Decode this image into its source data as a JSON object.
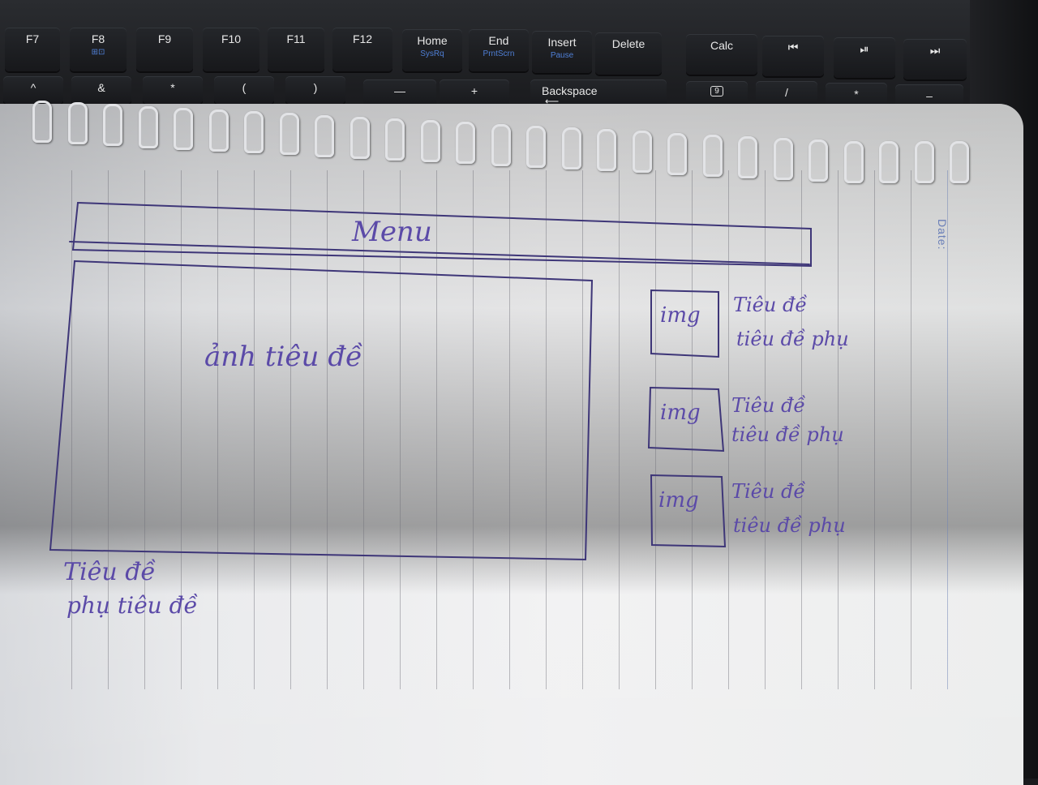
{
  "keyboard": {
    "row1": [
      {
        "id": "f7",
        "label": "F7",
        "sub": ""
      },
      {
        "id": "f8",
        "label": "F8",
        "sub": "⊞⊡"
      },
      {
        "id": "f9",
        "label": "F9",
        "sub": ""
      },
      {
        "id": "f10",
        "label": "F10",
        "sub": ""
      },
      {
        "id": "f11",
        "label": "F11",
        "sub": ""
      },
      {
        "id": "f12",
        "label": "F12",
        "sub": ""
      },
      {
        "id": "home",
        "label": "Home",
        "sub": "SysRq"
      },
      {
        "id": "end",
        "label": "End",
        "sub": "PrntScrn"
      },
      {
        "id": "insert",
        "label": "Insert",
        "sub": "Pause"
      },
      {
        "id": "delete",
        "label": "Delete",
        "sub": ""
      },
      {
        "id": "calc",
        "label": "Calc",
        "sub": ""
      },
      {
        "id": "prev",
        "label": "⏮",
        "sub": ""
      },
      {
        "id": "playpause",
        "label": "⏯",
        "sub": ""
      },
      {
        "id": "next",
        "label": "⏭",
        "sub": ""
      }
    ],
    "row2": [
      {
        "id": "caret",
        "label": "^"
      },
      {
        "id": "amp",
        "label": "&"
      },
      {
        "id": "star",
        "label": "*"
      },
      {
        "id": "lparen",
        "label": "("
      },
      {
        "id": "rparen",
        "label": ")"
      },
      {
        "id": "minus",
        "label": "—"
      },
      {
        "id": "plus",
        "label": "+"
      },
      {
        "id": "backspace",
        "label": "Backspace"
      },
      {
        "id": "lock",
        "label": "9"
      },
      {
        "id": "slash",
        "label": "/"
      },
      {
        "id": "npstar",
        "label": "*"
      },
      {
        "id": "npminus",
        "label": "–"
      }
    ]
  },
  "sketch": {
    "menu_label": "Menu",
    "hero_label": "ảnh tiêu đề",
    "hero_title": "Tiêu đề",
    "hero_subtitle": "phụ tiêu đề",
    "side_items": [
      {
        "img": "img",
        "title": "Tiêu đề",
        "subtitle": "tiêu đề phụ"
      },
      {
        "img": "img",
        "title": "Tiêu đề",
        "subtitle": "tiêu đề phụ"
      },
      {
        "img": "img",
        "title": "Tiêu đề",
        "subtitle": "tiêu đề phụ"
      }
    ],
    "date_label": "Date:"
  }
}
